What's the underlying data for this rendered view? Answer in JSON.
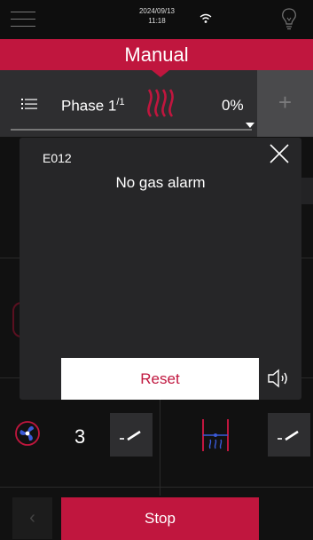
{
  "statusbar": {
    "date": "2024/09/13",
    "time": "11:18",
    "icons": [
      "menu-icon",
      "wifi-icon",
      "lightbulb-icon"
    ]
  },
  "header": {
    "title": "Manual",
    "color": "#c0163e"
  },
  "phase": {
    "label": "Phase 1",
    "superscript": "/1",
    "percent": "0%",
    "progress": 0
  },
  "modal": {
    "code": "E012",
    "message": "No gas alarm",
    "reset_label": "Reset"
  },
  "controls": {
    "fan_value": "3",
    "edit_label": "-"
  },
  "footer": {
    "stop_label": "Stop"
  },
  "colors": {
    "accent": "#c0163e",
    "background": "#111111",
    "panel": "#262628"
  }
}
